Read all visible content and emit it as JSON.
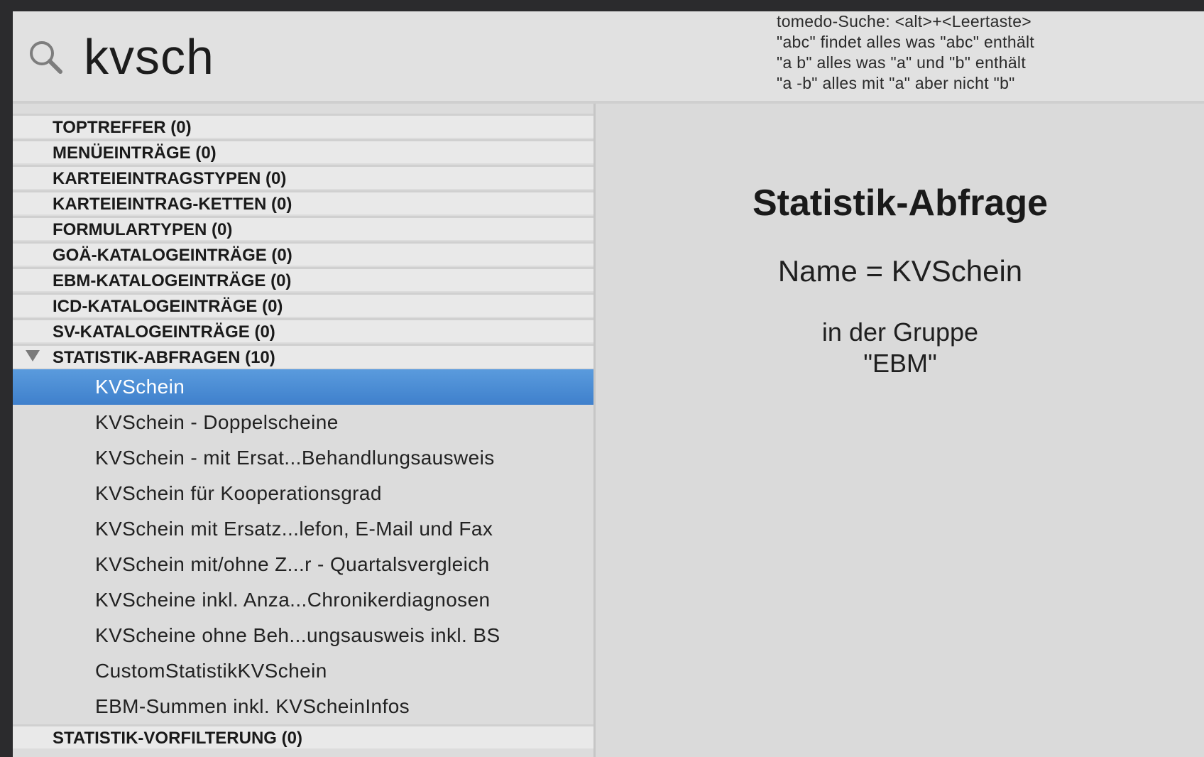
{
  "search": {
    "query": "kvsch",
    "help_lines": [
      "tomedo-Suche: <alt>+<Leertaste>",
      "\"abc\" findet alles was \"abc\" enthält",
      "\"a b\" alles was \"a\" und \"b\" enthält",
      "\"a -b\" alles mit \"a\" aber nicht \"b\""
    ]
  },
  "sections": [
    {
      "label": "TOPTREFFER (0)"
    },
    {
      "label": "MENÜEINTRÄGE (0)"
    },
    {
      "label": "KARTEIEINTRAGSTYPEN (0)"
    },
    {
      "label": "KARTEIEINTRAG-KETTEN (0)"
    },
    {
      "label": "FORMULARTYPEN (0)"
    },
    {
      "label": "GOÄ-KATALOGEINTRÄGE (0)"
    },
    {
      "label": "EBM-KATALOGEINTRÄGE (0)"
    },
    {
      "label": "ICD-KATALOGEINTRÄGE (0)"
    },
    {
      "label": "SV-KATALOGEINTRÄGE (0)"
    },
    {
      "label": "STATISTIK-ABFRAGEN (10)"
    },
    {
      "label": "STATISTIK-VORFILTERUNG (0)"
    }
  ],
  "statistik_items": [
    {
      "label": "KVSchein"
    },
    {
      "label": "KVSchein - Doppelscheine"
    },
    {
      "label": "KVSchein - mit Ersat...Behandlungsausweis"
    },
    {
      "label": "KVSchein für Kooperationsgrad"
    },
    {
      "label": "KVSchein mit Ersatz...lefon, E-Mail und Fax"
    },
    {
      "label": "KVSchein mit/ohne Z...r - Quartalsvergleich"
    },
    {
      "label": "KVScheine inkl. Anza...Chronikerdiagnosen"
    },
    {
      "label": "KVScheine ohne Beh...ungsausweis inkl. BS"
    },
    {
      "label": "CustomStatistikKVSchein"
    },
    {
      "label": "EBM-Summen inkl. KVScheinInfos"
    }
  ],
  "detail": {
    "title": "Statistik-Abfrage",
    "name_line": "Name = KVSchein",
    "group_line1": "in der Gruppe",
    "group_line2": "\"EBM\""
  },
  "colors": {
    "selection": "#4a8fd8",
    "background": "#dadada"
  }
}
